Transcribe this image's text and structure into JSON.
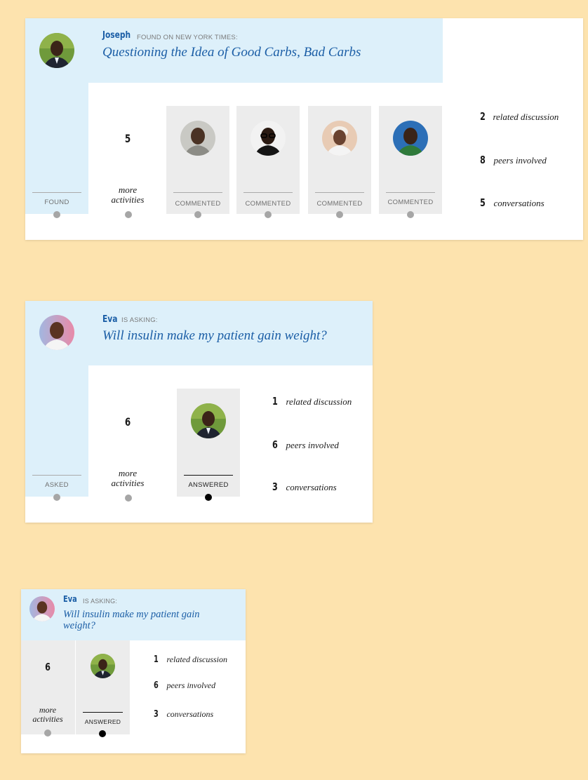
{
  "cards": [
    {
      "user_name": "Joseph",
      "action": "FOUND ON NEW YORK TIMES:",
      "title": "Questioning the Idea of Good Carbs, Bad Carbs",
      "poster_step_label": "FOUND",
      "more_count": "5",
      "more_label": "more activities",
      "activities": [
        "COMMENTED",
        "COMMENTED",
        "COMMENTED",
        "COMMENTED"
      ],
      "stats": [
        {
          "count": "2",
          "label": "related discussion"
        },
        {
          "count": "8",
          "label": "peers involved"
        },
        {
          "count": "5",
          "label": "conversations"
        }
      ]
    },
    {
      "user_name": "Eva",
      "action": "IS ASKING:",
      "title": "Will insulin make my patient gain weight?",
      "poster_step_label": "ASKED",
      "more_count": "6",
      "more_label": "more activities",
      "activities": [
        "ANSWERED"
      ],
      "stats": [
        {
          "count": "1",
          "label": "related discussion"
        },
        {
          "count": "6",
          "label": "peers involved"
        },
        {
          "count": "3",
          "label": "conversations"
        }
      ]
    },
    {
      "user_name": "Eva",
      "action": "IS ASKING:",
      "title": "Will insulin make my patient gain weight?",
      "more_count": "6",
      "more_label": "more activities",
      "activities": [
        "ANSWERED"
      ],
      "stats": [
        {
          "count": "1",
          "label": "related discussion"
        },
        {
          "count": "6",
          "label": "peers involved"
        },
        {
          "count": "3",
          "label": "conversations"
        }
      ]
    }
  ]
}
